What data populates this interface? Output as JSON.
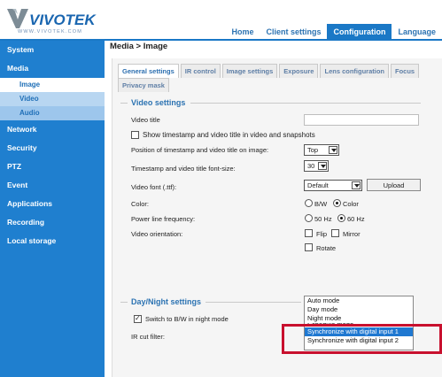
{
  "brand": {
    "name": "VIVOTEK",
    "url_text": "WWW.VIVOTEK.COM"
  },
  "topnav": [
    {
      "label": "Home",
      "active": false
    },
    {
      "label": "Client settings",
      "active": false
    },
    {
      "label": "Configuration",
      "active": true
    },
    {
      "label": "Language",
      "active": false
    }
  ],
  "breadcrumb": "Media > Image",
  "sidebar": {
    "items": [
      {
        "label": "System"
      },
      {
        "label": "Media"
      },
      {
        "label": "Image",
        "sub": true,
        "active": true
      },
      {
        "label": "Video",
        "sub": true
      },
      {
        "label": "Audio",
        "sub": true
      },
      {
        "label": "Network"
      },
      {
        "label": "Security"
      },
      {
        "label": "PTZ"
      },
      {
        "label": "Event"
      },
      {
        "label": "Applications"
      },
      {
        "label": "Recording"
      },
      {
        "label": "Local storage"
      }
    ]
  },
  "tabs": {
    "row1": [
      "General settings",
      "IR control",
      "Image settings",
      "Exposure",
      "Lens configuration",
      "Focus"
    ],
    "row2": [
      "Privacy mask"
    ],
    "active": "General settings"
  },
  "video_settings": {
    "title": "Video settings",
    "video_title_label": "Video title",
    "video_title_value": "",
    "show_timestamp_label": "Show timestamp and video title in video and snapshots",
    "show_timestamp_checked": false,
    "position_label": "Position of timestamp and video title on image:",
    "position_value": "Top",
    "font_size_label": "Timestamp and video title font-size:",
    "font_size_value": "30",
    "video_font_label": "Video font (.ttf):",
    "video_font_value": "Default",
    "upload_label": "Upload",
    "color_label": "Color:",
    "color_bw_label": "B/W",
    "color_color_label": "Color",
    "color_selected": "Color",
    "power_label": "Power line frequency:",
    "power_50_label": "50 Hz",
    "power_60_label": "60 Hz",
    "power_selected": "60 Hz",
    "orientation_label": "Video orientation:",
    "flip_label": "Flip",
    "mirror_label": "Mirror",
    "rotate_label": "Rotate"
  },
  "day_night": {
    "title": "Day/Night settings",
    "switch_bw_label": "Switch to B/W in night mode",
    "switch_bw_checked": true,
    "ir_cut_label": "IR cut filter:",
    "dropdown_options": [
      "Auto mode",
      "Day mode",
      "Night mode",
      "Schedule mode",
      "Synchronize with digital input 1",
      "Synchronize with digital input 2"
    ],
    "dropdown_selected": "Synchronize with digital input 1"
  },
  "colors": {
    "brand_blue": "#1a78c6",
    "sidebar_blue": "#1f7fcf",
    "highlight_red": "#c8102e"
  }
}
